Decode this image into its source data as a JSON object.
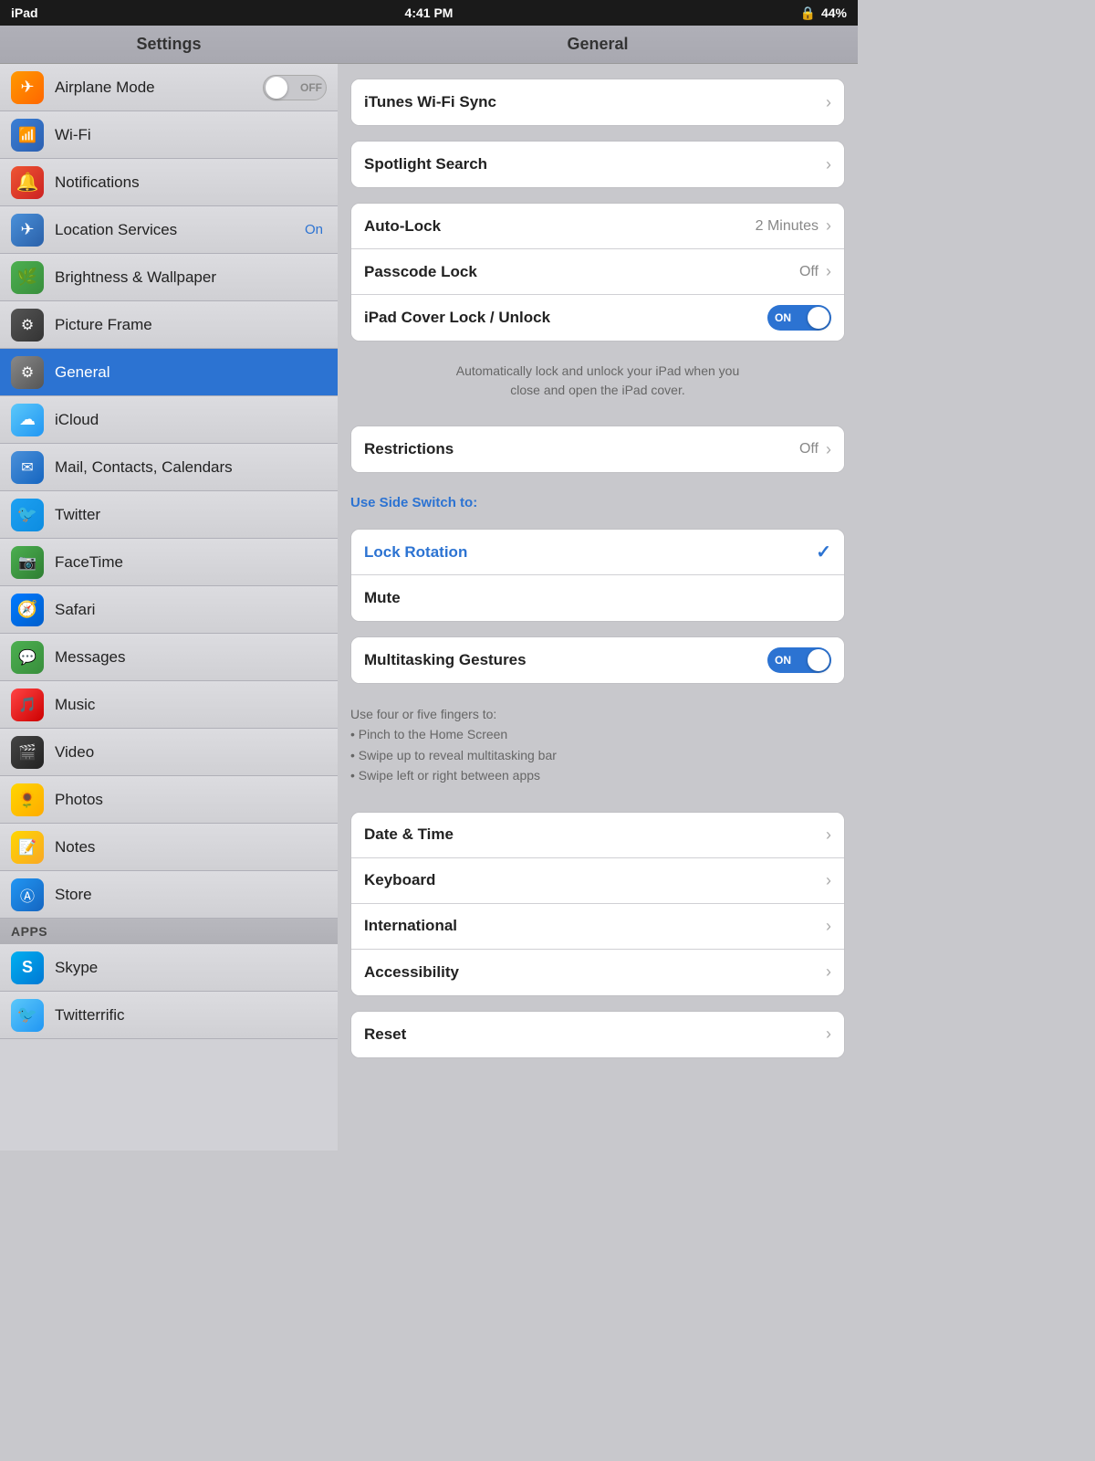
{
  "statusBar": {
    "left": "iPad",
    "wifi": "wifi",
    "center": "4:41 PM",
    "lock": "🔒",
    "battery": "44%"
  },
  "sidebar": {
    "header": "Settings",
    "items": [
      {
        "id": "airplane",
        "label": "Airplane Mode",
        "icon": "✈",
        "iconClass": "icon-airplane",
        "hasToggle": true,
        "toggleState": "off"
      },
      {
        "id": "wifi",
        "label": "Wi-Fi",
        "icon": "📶",
        "iconClass": "icon-wifi",
        "hasChevron": false
      },
      {
        "id": "notifications",
        "label": "Notifications",
        "icon": "🔴",
        "iconClass": "icon-notifications"
      },
      {
        "id": "location",
        "label": "Location Services",
        "icon": "✈",
        "iconClass": "icon-location",
        "value": "On"
      },
      {
        "id": "brightness",
        "label": "Brightness & Wallpaper",
        "icon": "🌿",
        "iconClass": "icon-brightness"
      },
      {
        "id": "pictureframe",
        "label": "Picture Frame",
        "icon": "⚙",
        "iconClass": "icon-pictureframe"
      },
      {
        "id": "general",
        "label": "General",
        "icon": "⚙",
        "iconClass": "icon-general",
        "active": true
      },
      {
        "id": "icloud",
        "label": "iCloud",
        "icon": "☁",
        "iconClass": "icon-icloud"
      },
      {
        "id": "mail",
        "label": "Mail, Contacts, Calendars",
        "icon": "✉",
        "iconClass": "icon-mail"
      },
      {
        "id": "twitter",
        "label": "Twitter",
        "icon": "🐦",
        "iconClass": "icon-twitter"
      },
      {
        "id": "facetime",
        "label": "FaceTime",
        "icon": "📷",
        "iconClass": "icon-facetime"
      },
      {
        "id": "safari",
        "label": "Safari",
        "icon": "🧭",
        "iconClass": "icon-safari"
      },
      {
        "id": "messages",
        "label": "Messages",
        "icon": "💬",
        "iconClass": "icon-messages"
      },
      {
        "id": "music",
        "label": "Music",
        "icon": "🎵",
        "iconClass": "icon-music"
      },
      {
        "id": "video",
        "label": "Video",
        "icon": "🎬",
        "iconClass": "icon-video"
      },
      {
        "id": "photos",
        "label": "Photos",
        "icon": "🌻",
        "iconClass": "icon-photos"
      },
      {
        "id": "notes",
        "label": "Notes",
        "icon": "📝",
        "iconClass": "icon-notes"
      },
      {
        "id": "store",
        "label": "Store",
        "icon": "🅐",
        "iconClass": "icon-store"
      }
    ],
    "appsSection": "Apps",
    "appsItems": [
      {
        "id": "skype",
        "label": "Skype",
        "icon": "S",
        "iconClass": "icon-skype"
      },
      {
        "id": "twitterrific",
        "label": "Twitterrific",
        "icon": "🐦",
        "iconClass": "icon-twitterrific"
      }
    ]
  },
  "content": {
    "header": "General",
    "groups": [
      {
        "id": "top-group",
        "rows": [
          {
            "id": "itunes-wifi-sync",
            "label": "iTunes Wi-Fi Sync",
            "hasChevron": true
          }
        ]
      },
      {
        "id": "spotlight-group",
        "rows": [
          {
            "id": "spotlight-search",
            "label": "Spotlight Search",
            "hasChevron": true
          }
        ]
      },
      {
        "id": "lock-group",
        "rows": [
          {
            "id": "auto-lock",
            "label": "Auto-Lock",
            "value": "2 Minutes",
            "hasChevron": true
          },
          {
            "id": "passcode-lock",
            "label": "Passcode Lock",
            "value": "Off",
            "hasChevron": true
          },
          {
            "id": "ipad-cover",
            "label": "iPad Cover Lock / Unlock",
            "hasToggle": true,
            "toggleState": "on"
          }
        ],
        "description": "Automatically lock and unlock your iPad when you\nclose and open the iPad cover."
      },
      {
        "id": "restrictions-group",
        "rows": [
          {
            "id": "restrictions",
            "label": "Restrictions",
            "value": "Off",
            "hasChevron": true
          }
        ]
      },
      {
        "id": "side-switch-group",
        "sectionLabel": "Use Side Switch to:",
        "rows": [
          {
            "id": "lock-rotation",
            "label": "Lock Rotation",
            "selected": true,
            "hasCheck": true
          },
          {
            "id": "mute",
            "label": "Mute"
          }
        ]
      },
      {
        "id": "multitasking-group",
        "rows": [
          {
            "id": "multitasking-gestures",
            "label": "Multitasking Gestures",
            "hasToggle": true,
            "toggleState": "on"
          }
        ],
        "descriptionLeft": "Use four or five fingers to:\n• Pinch to the Home Screen\n• Swipe up to reveal multitasking bar\n• Swipe left or right between apps"
      },
      {
        "id": "bottom-group",
        "rows": [
          {
            "id": "date-time",
            "label": "Date & Time",
            "hasChevron": true
          },
          {
            "id": "keyboard",
            "label": "Keyboard",
            "hasChevron": true
          },
          {
            "id": "international",
            "label": "International",
            "hasChevron": true
          },
          {
            "id": "accessibility",
            "label": "Accessibility",
            "hasChevron": true
          }
        ]
      },
      {
        "id": "reset-group",
        "rows": [
          {
            "id": "reset",
            "label": "Reset",
            "hasChevron": true
          }
        ]
      }
    ]
  }
}
